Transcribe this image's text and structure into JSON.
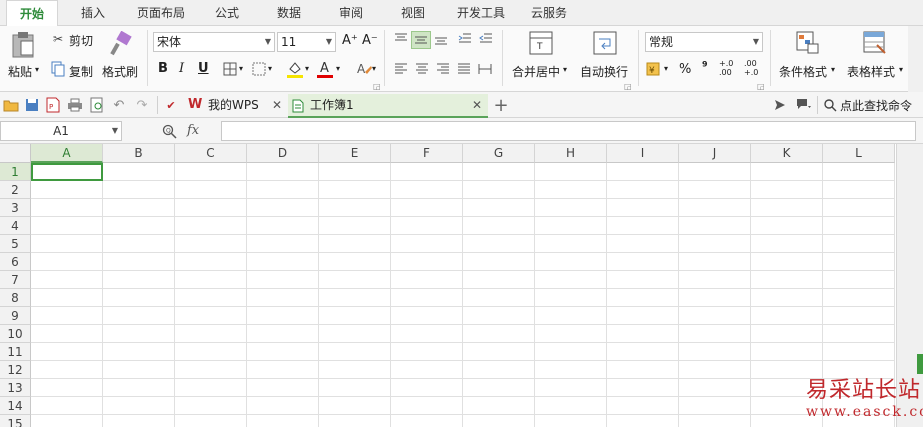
{
  "ribbon_tabs": [
    "开始",
    "插入",
    "页面布局",
    "公式",
    "数据",
    "审阅",
    "视图",
    "开发工具",
    "云服务"
  ],
  "clipboard": {
    "paste": "粘贴",
    "cut": "剪切",
    "copy": "复制",
    "format_painter": "格式刷"
  },
  "font": {
    "name": "宋体",
    "size": "11",
    "grow": "A⁺",
    "shrink": "A⁻",
    "bold": "B",
    "italic": "I",
    "underline": "U"
  },
  "alignment": {
    "merge_center": "合并居中",
    "wrap_text": "自动换行"
  },
  "number": {
    "format": "常规",
    "percent": "%",
    "comma": "⁹",
    "inc_decimal": "+.0 .00",
    "dec_decimal": ".00 +.0"
  },
  "styles": {
    "conditional_format": "条件格式",
    "table_style": "表格样式"
  },
  "doc_tabs": [
    {
      "label": "我的WPS"
    },
    {
      "label": "工作簿1"
    }
  ],
  "search_command": "点此查找命令",
  "name_box": "A1",
  "fx_label": "fx",
  "columns": [
    "A",
    "B",
    "C",
    "D",
    "E",
    "F",
    "G",
    "H",
    "I",
    "J",
    "K",
    "L"
  ],
  "rows": [
    "1",
    "2",
    "3",
    "4",
    "5",
    "6",
    "7",
    "8",
    "9",
    "10",
    "11",
    "12",
    "13",
    "14",
    "15"
  ],
  "watermark": {
    "text": "易采站长站",
    "url": "www.easck.com"
  },
  "colors": {
    "accent": "#2e8b3a",
    "selection": "#3f9a3f",
    "watermark": "#c0282c"
  }
}
